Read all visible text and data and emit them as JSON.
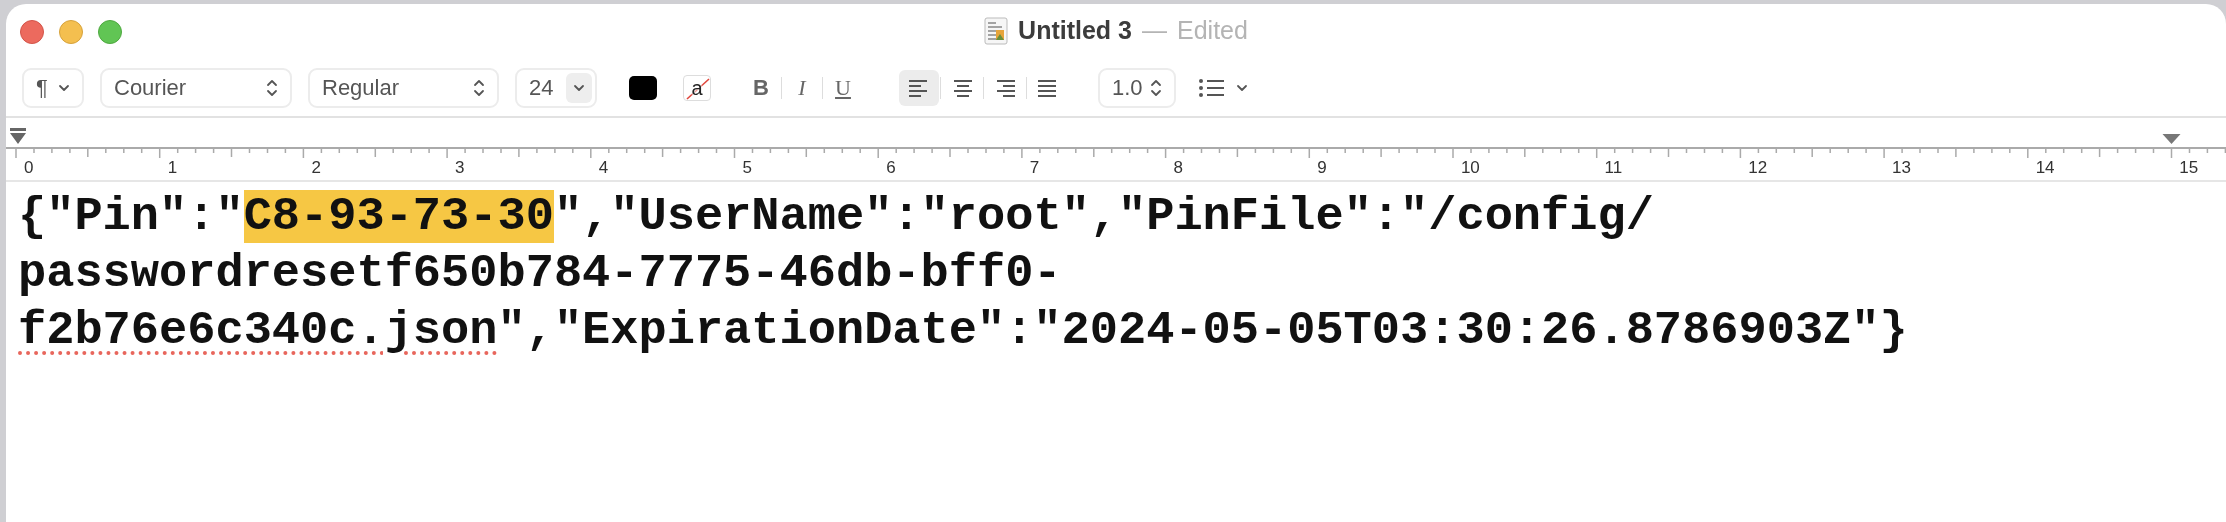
{
  "window": {
    "title": "Untitled 3",
    "separator": "—",
    "status": "Edited"
  },
  "toolbar": {
    "paragraph_style": "¶",
    "font_family": "Courier",
    "font_style": "Regular",
    "font_size": "24",
    "background_color_label": "a",
    "styles": [
      {
        "label": "B",
        "kind": "bold",
        "selected": false
      },
      {
        "label": "I",
        "kind": "italic",
        "selected": false
      },
      {
        "label": "U",
        "kind": "underline",
        "selected": false
      }
    ],
    "alignment": [
      {
        "kind": "left",
        "selected": true
      },
      {
        "kind": "center",
        "selected": false
      },
      {
        "kind": "right",
        "selected": false
      },
      {
        "kind": "justify",
        "selected": false
      }
    ],
    "line_spacing": "1.0"
  },
  "ruler": {
    "labels": [
      "0",
      "1",
      "2",
      "3",
      "4",
      "5",
      "6",
      "7",
      "8",
      "9",
      "10",
      "11",
      "12",
      "13",
      "14",
      "15"
    ]
  },
  "document": {
    "lines": [
      [
        {
          "kind": "plain",
          "text": "{\"Pin\":\""
        },
        {
          "kind": "highlight",
          "text": "C8-93-73-30"
        },
        {
          "kind": "plain",
          "text": "\",\"UserName\":\"root\",\"PinFile\":\"/config/"
        }
      ],
      [
        {
          "kind": "plain",
          "text": "passwordresetf650b784-7775-46db-bff0-"
        }
      ],
      [
        {
          "kind": "misspelled",
          "text": "f2b76e6c340c.json"
        },
        {
          "kind": "plain",
          "text": "\",\"ExpirationDate\":\"2024-05-05T03:30:26.8786903Z\"}"
        }
      ]
    ]
  }
}
